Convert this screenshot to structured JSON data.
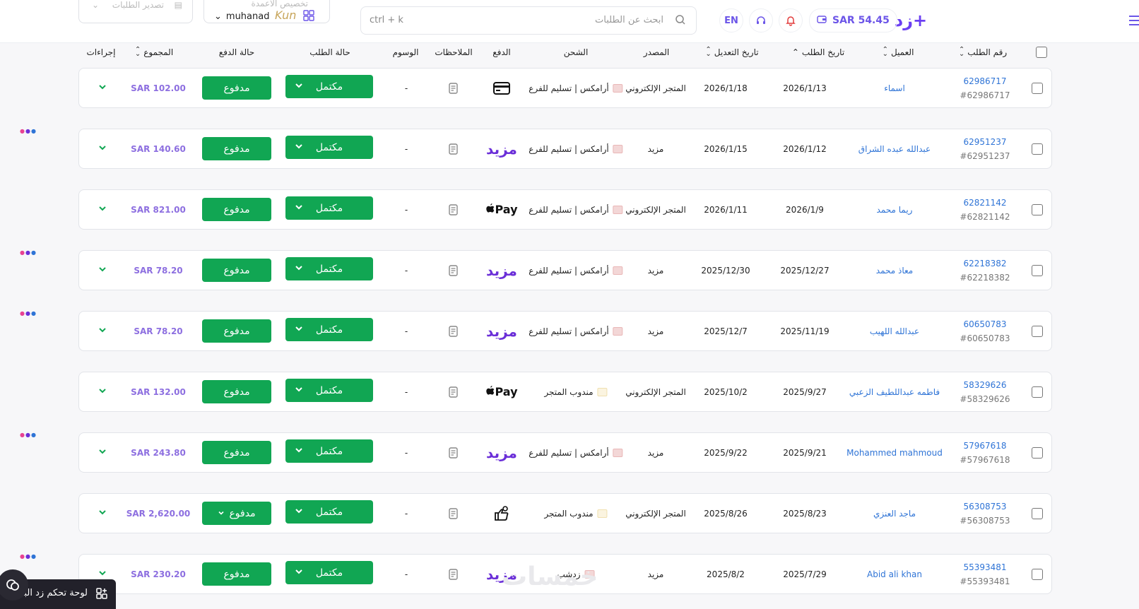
{
  "header": {
    "logo": "زد+",
    "balance": "SAR  54.45",
    "lang": "EN",
    "search_shortcut": "ctrl + k",
    "search_placeholder": "ابحث عن الطلبات",
    "export_label": "تصدير الطلبات",
    "columns_label": "تخصيص الأعمدة",
    "username": "muhanad",
    "brand_mark": "Kun"
  },
  "columns": {
    "order_no": "رقم الطلب",
    "customer": "العميل",
    "order_date": "تاريخ الطلب",
    "modified_date": "تاريخ التعديل",
    "source": "المصدر",
    "shipping": "الشحن",
    "payment": "الدفع",
    "notes": "الملاحظات",
    "tags": "الوسوم",
    "order_status": "حالة الطلب",
    "payment_status": "حالة الدفع",
    "total": "المجموع",
    "actions": "إجراءات"
  },
  "rows": [
    {
      "id": "62986717",
      "ref": "#62986717",
      "customer": "اسماء",
      "order_date": "2026/1/13",
      "modified": "2026/1/18",
      "source": "المتجر الإلكتروني",
      "shipping": "أرامكس | تسليم للفرع",
      "payment": "card-icon",
      "tags": "-",
      "status": "مكتمل",
      "pay_status": "مدفوع",
      "total": "SAR 102.00"
    },
    {
      "id": "62951237",
      "ref": "#62951237",
      "customer": "عبدالله عبده الشراق",
      "order_date": "2026/1/12",
      "modified": "2026/1/15",
      "source": "مزيد",
      "shipping": "أرامكس | تسليم للفرع",
      "payment": "mazeed",
      "tags": "-",
      "status": "مكتمل",
      "pay_status": "مدفوع",
      "total": "SAR 140.60"
    },
    {
      "id": "62821142",
      "ref": "#62821142",
      "customer": "ريما محمد",
      "order_date": "2026/1/9",
      "modified": "2026/1/11",
      "source": "المتجر الإلكتروني",
      "shipping": "أرامكس | تسليم للفرع",
      "payment": "applepay",
      "tags": "-",
      "status": "مكتمل",
      "pay_status": "مدفوع",
      "total": "SAR 821.00"
    },
    {
      "id": "62218382",
      "ref": "#62218382",
      "customer": "معاذ محمد",
      "order_date": "2025/12/27",
      "modified": "2025/12/30",
      "source": "مزيد",
      "shipping": "أرامكس | تسليم للفرع",
      "payment": "mazeed",
      "tags": "-",
      "status": "مكتمل",
      "pay_status": "مدفوع",
      "total": "SAR 78.20"
    },
    {
      "id": "60650783",
      "ref": "#60650783",
      "customer": "عبدالله اللهيب",
      "order_date": "2025/11/19",
      "modified": "2025/12/7",
      "source": "مزيد",
      "shipping": "أرامكس | تسليم للفرع",
      "payment": "mazeed",
      "tags": "-",
      "status": "مكتمل",
      "pay_status": "مدفوع",
      "total": "SAR 78.20"
    },
    {
      "id": "58329626",
      "ref": "#58329626",
      "customer": "فاطمه عبداللطيف الزعبي",
      "order_date": "2025/9/27",
      "modified": "2025/10/2",
      "source": "المتجر الإلكتروني",
      "shipping": "مندوب المتجر",
      "payment": "applepay",
      "tags": "-",
      "status": "مكتمل",
      "pay_status": "مدفوع",
      "total": "SAR 132.00"
    },
    {
      "id": "57967618",
      "ref": "#57967618",
      "customer": "Mohammed mahmoud",
      "order_date": "2025/9/21",
      "modified": "2025/9/22",
      "source": "مزيد",
      "shipping": "أرامكس | تسليم للفرع",
      "payment": "mazeed",
      "tags": "-",
      "status": "مكتمل",
      "pay_status": "مدفوع",
      "total": "SAR 243.80"
    },
    {
      "id": "56308753",
      "ref": "#56308753",
      "customer": "ماجد العنزي",
      "order_date": "2025/8/23",
      "modified": "2025/8/26",
      "source": "المتجر الإلكتروني",
      "shipping": "مندوب المتجر",
      "payment": "cash-icon",
      "tags": "-",
      "status": "مكتمل",
      "pay_status": "مدفوع",
      "total": "SAR 2,620.00"
    },
    {
      "id": "55393481",
      "ref": "#55393481",
      "customer": "Abid ali khan",
      "order_date": "2025/7/29",
      "modified": "2025/8/2",
      "source": "مزيد",
      "shipping": "زدشب",
      "payment": "mazeed",
      "tags": "-",
      "status": "مكتمل",
      "pay_status": "مدفوع",
      "total": "SAR 230.20"
    }
  ],
  "payment_labels": {
    "applepay": "Pay",
    "mazeed": "مزيد"
  },
  "footer": {
    "dashboard_label": "لوحة تحكم زد البـ",
    "watermark": "خمسات"
  },
  "colors": {
    "accent": "#6b55e8",
    "success": "#11a653",
    "link": "#2f74d6",
    "total": "#8d6fe0"
  }
}
